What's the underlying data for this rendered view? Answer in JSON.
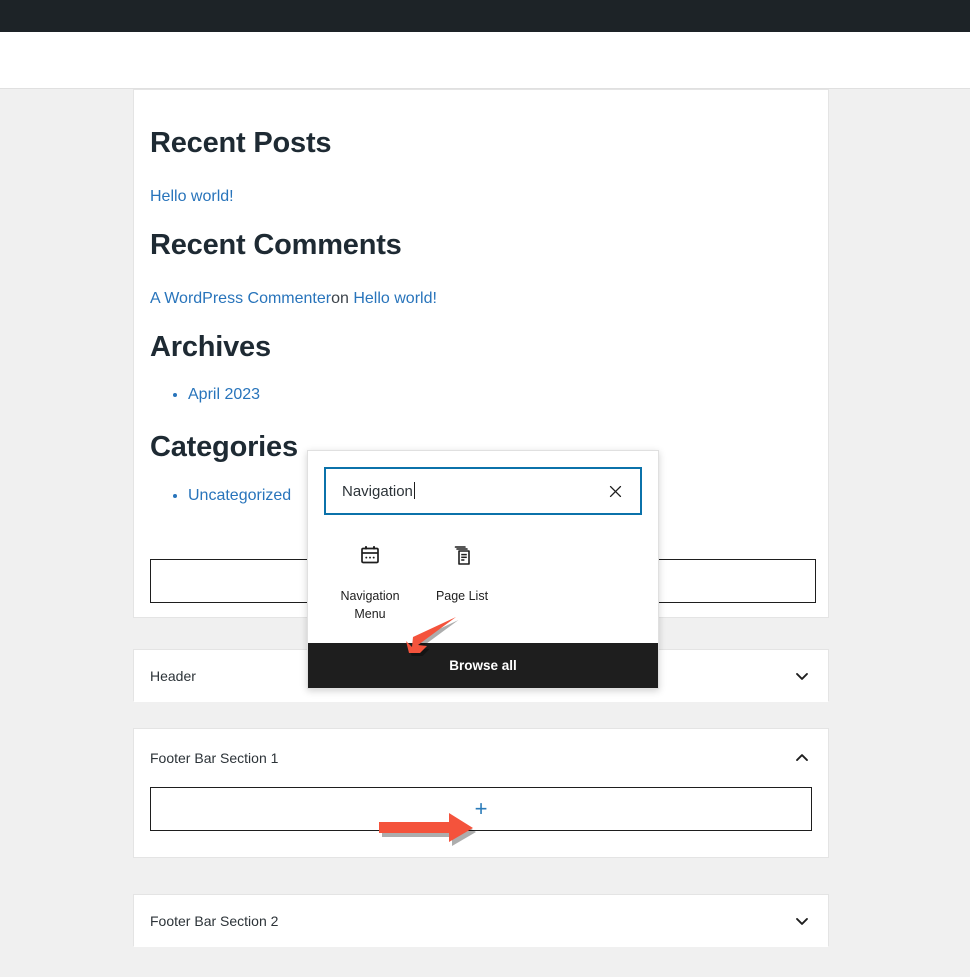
{
  "preview": {
    "sections": [
      {
        "kind": "heading",
        "text": "Recent Posts"
      },
      {
        "kind": "link",
        "text": "Hello world!"
      },
      {
        "kind": "heading",
        "text": "Recent Comments"
      },
      {
        "kind": "comment",
        "author": "A WordPress Commenter",
        "on": "on",
        "post": "Hello world!"
      },
      {
        "kind": "heading",
        "text": "Archives"
      },
      {
        "kind": "listitem",
        "text": "April 2023"
      },
      {
        "kind": "heading",
        "text": "Categories"
      },
      {
        "kind": "listitem",
        "text": "Uncategorized"
      }
    ],
    "headings": {
      "recent_posts": "Recent Posts",
      "recent_comments": "Recent Comments",
      "archives": "Archives",
      "categories": "Categories"
    },
    "links": {
      "hello_world": "Hello world!",
      "commenter": "A WordPress Commenter",
      "comment_on": "on",
      "comment_post": "Hello world!",
      "april_2023": "April 2023",
      "uncategorized": "Uncategorized"
    }
  },
  "inserter": {
    "search": {
      "value": "Navigation",
      "placeholder": "Search",
      "clear_icon": "close-icon"
    },
    "results": [
      {
        "label": "Navigation Menu",
        "icon": "navigation-menu-icon"
      },
      {
        "label": "Page List",
        "icon": "page-list-icon"
      }
    ],
    "browse_all_label": "Browse all"
  },
  "accordions": [
    {
      "title": "Header",
      "expanded": false,
      "chevron": "chevron-down-icon"
    },
    {
      "title": "Footer Bar Section 1",
      "expanded": true,
      "chevron": "chevron-up-icon"
    },
    {
      "title": "Footer Bar Section 2",
      "expanded": false,
      "chevron": "chevron-down-icon"
    }
  ],
  "appender": {
    "plus_label": "+",
    "icon": "plus-icon"
  },
  "colors": {
    "admin_bar": "#1d2327",
    "canvas_bg": "#f0f0f0",
    "panel_bg": "#ffffff",
    "link_blue": "#2874bb",
    "focus_blue": "#0b72aa",
    "plus_blue": "#2b7bb9",
    "browse_all_bg": "#1e1e1e",
    "arrow_red": "#f4533c"
  }
}
